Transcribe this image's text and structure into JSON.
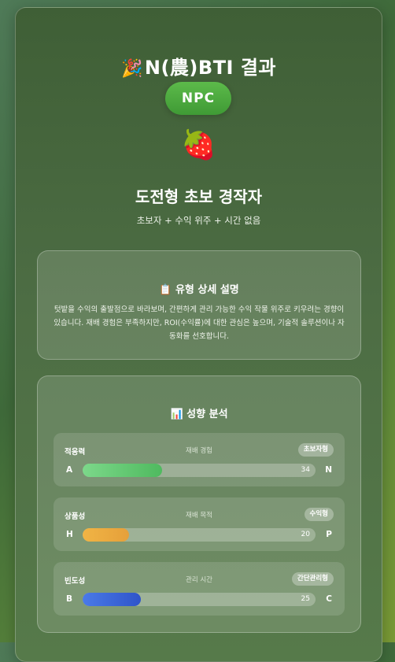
{
  "result": {
    "title_emoji": "🎉",
    "title_text": "N(農)BTI 결과",
    "badge": "NPC",
    "fruit_emoji": "🍓",
    "type_name": "도전형 초보 경작자",
    "type_sub": "초보자 + 수익 위주 + 시간 없음"
  },
  "description": {
    "title": "📋 유형 상세 설명",
    "text": "텃밭을 수익의 출발점으로 바라보며, 간편하게 관리 가능한 수익 작물 위주로 키우려는 경향이 있습니다. 재배 경험은 부족하지만, ROI(수익률)에 대한 관심은 높으며, 기술적 솔루션이나 자동화를 선호합니다."
  },
  "analysis": {
    "title": "📊 성향 분석",
    "traits": [
      {
        "name": "적응력",
        "category": "재배 경험",
        "tag": "초보자형",
        "left": "A",
        "right": "N",
        "value": 34,
        "color": "#5cc46c"
      },
      {
        "name": "상품성",
        "category": "재배 목적",
        "tag": "수익형",
        "left": "H",
        "right": "P",
        "value": 20,
        "color": "#e8a83e"
      },
      {
        "name": "빈도성",
        "category": "관리 시간",
        "tag": "간단관리형",
        "left": "B",
        "right": "C",
        "value": 25,
        "color": "#3a62d8"
      }
    ]
  }
}
